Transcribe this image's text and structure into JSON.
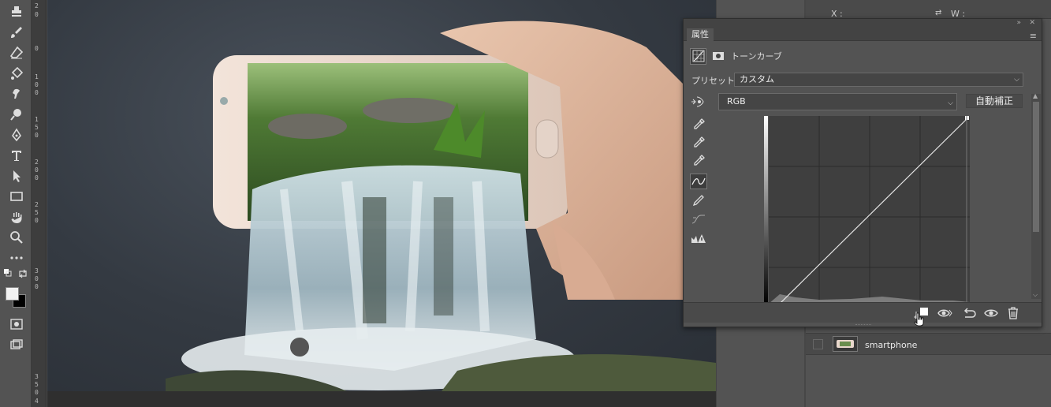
{
  "panel": {
    "tab_label": "属性",
    "adjustment_name": "トーンカーブ",
    "preset_label": "プリセット：",
    "preset_value": "カスタム",
    "channel_value": "RGB",
    "auto_button": "自動補正"
  },
  "transform": {
    "x_label": "X :",
    "w_label": "W :"
  },
  "layer": {
    "name": "smartphone"
  },
  "ruler": {
    "labels": [
      "2",
      "0",
      "0",
      "1",
      "0",
      "0",
      "1",
      "5",
      "0",
      "2",
      "0",
      "0",
      "2",
      "5",
      "0",
      "3",
      "0",
      "0",
      "3",
      "5",
      "0",
      "4"
    ]
  },
  "curve": {
    "input_start": 0,
    "output_start": 0,
    "input_end": 255,
    "output_end": 255
  },
  "colors": {
    "panel_bg": "#535353",
    "canvas_bg": "#343a42",
    "curve_line": "#e6e6e6"
  },
  "icons": [
    "stamp-icon",
    "history-brush-icon",
    "eraser-icon",
    "paint-bucket-icon",
    "smudge-icon",
    "dodge-icon",
    "pen-icon",
    "type-icon",
    "path-select-icon",
    "rectangle-icon",
    "hand-icon",
    "zoom-icon",
    "more-icon",
    "eyedropper-icon",
    "curve-icon",
    "pencil-icon",
    "clip-icon",
    "visibility-icon",
    "reset-icon",
    "trash-icon"
  ]
}
